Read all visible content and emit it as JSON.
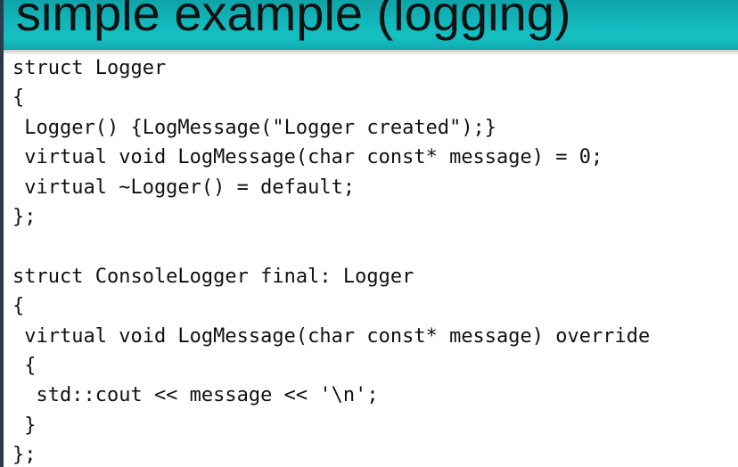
{
  "slide": {
    "title": "simple example (logging)",
    "code_lines": [
      "struct Logger",
      "{",
      " Logger() {LogMessage(\"Logger created\");}",
      " virtual void LogMessage(char const* message) = 0;",
      " virtual ~Logger() = default;",
      "};",
      "",
      "struct ConsoleLogger final: Logger",
      "{",
      " virtual void LogMessage(char const* message) override",
      " {",
      "  std::cout << message << '\\n';",
      " }",
      "};"
    ]
  },
  "colors": {
    "header_accent": "#14c0c3",
    "background": "#ffffff",
    "text": "#111111"
  }
}
